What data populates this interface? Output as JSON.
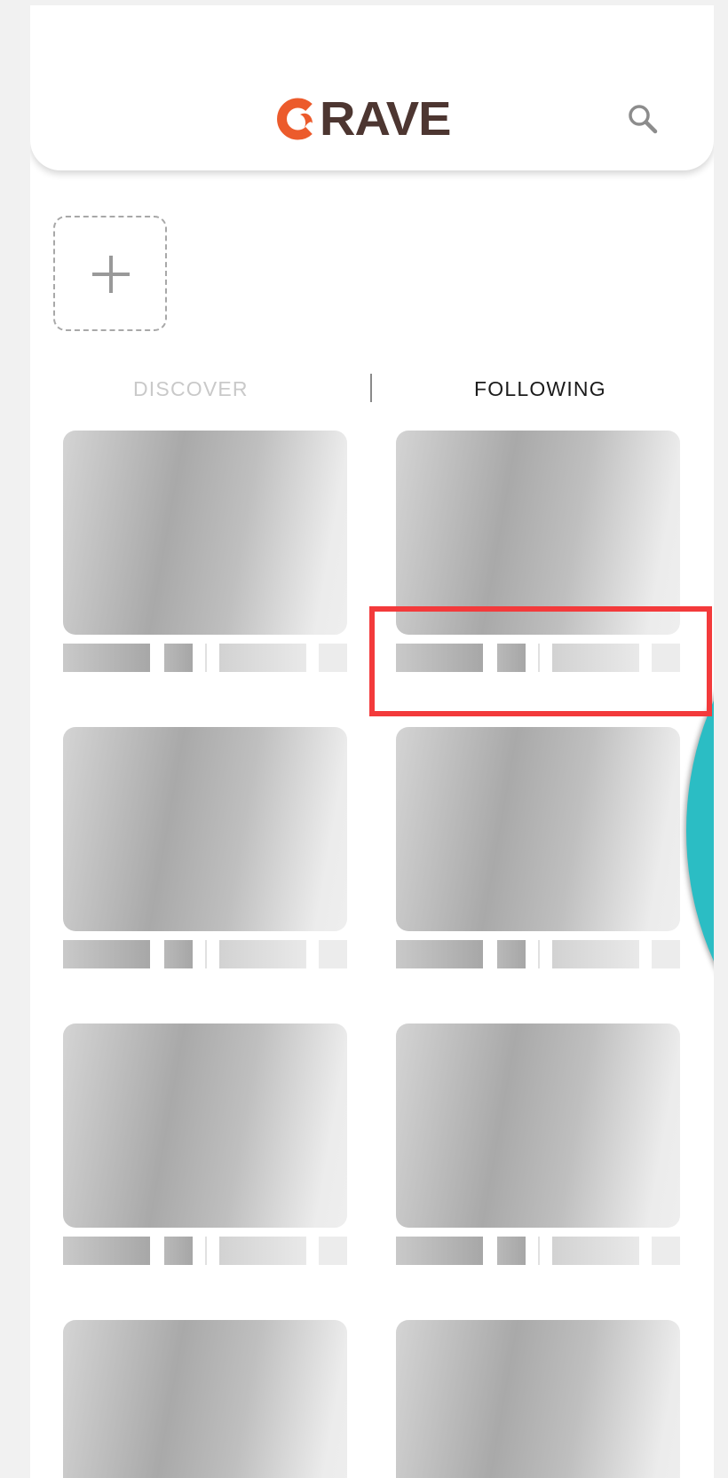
{
  "header": {
    "logo_text": "RAVE",
    "logo_accent_letter": "C",
    "brand_colors": {
      "accent": "#ec5b2c",
      "text": "#4d3631"
    }
  },
  "add_story": {
    "icon": "plus-icon"
  },
  "tabs": [
    {
      "label": "DISCOVER",
      "active": false
    },
    {
      "label": "FOLLOWING",
      "active": true
    }
  ],
  "feed": {
    "state": "loading-placeholders",
    "item_count": 8
  },
  "fab": {
    "color": "#2bbdc4"
  },
  "highlight": {
    "color": "#f33a3b"
  }
}
